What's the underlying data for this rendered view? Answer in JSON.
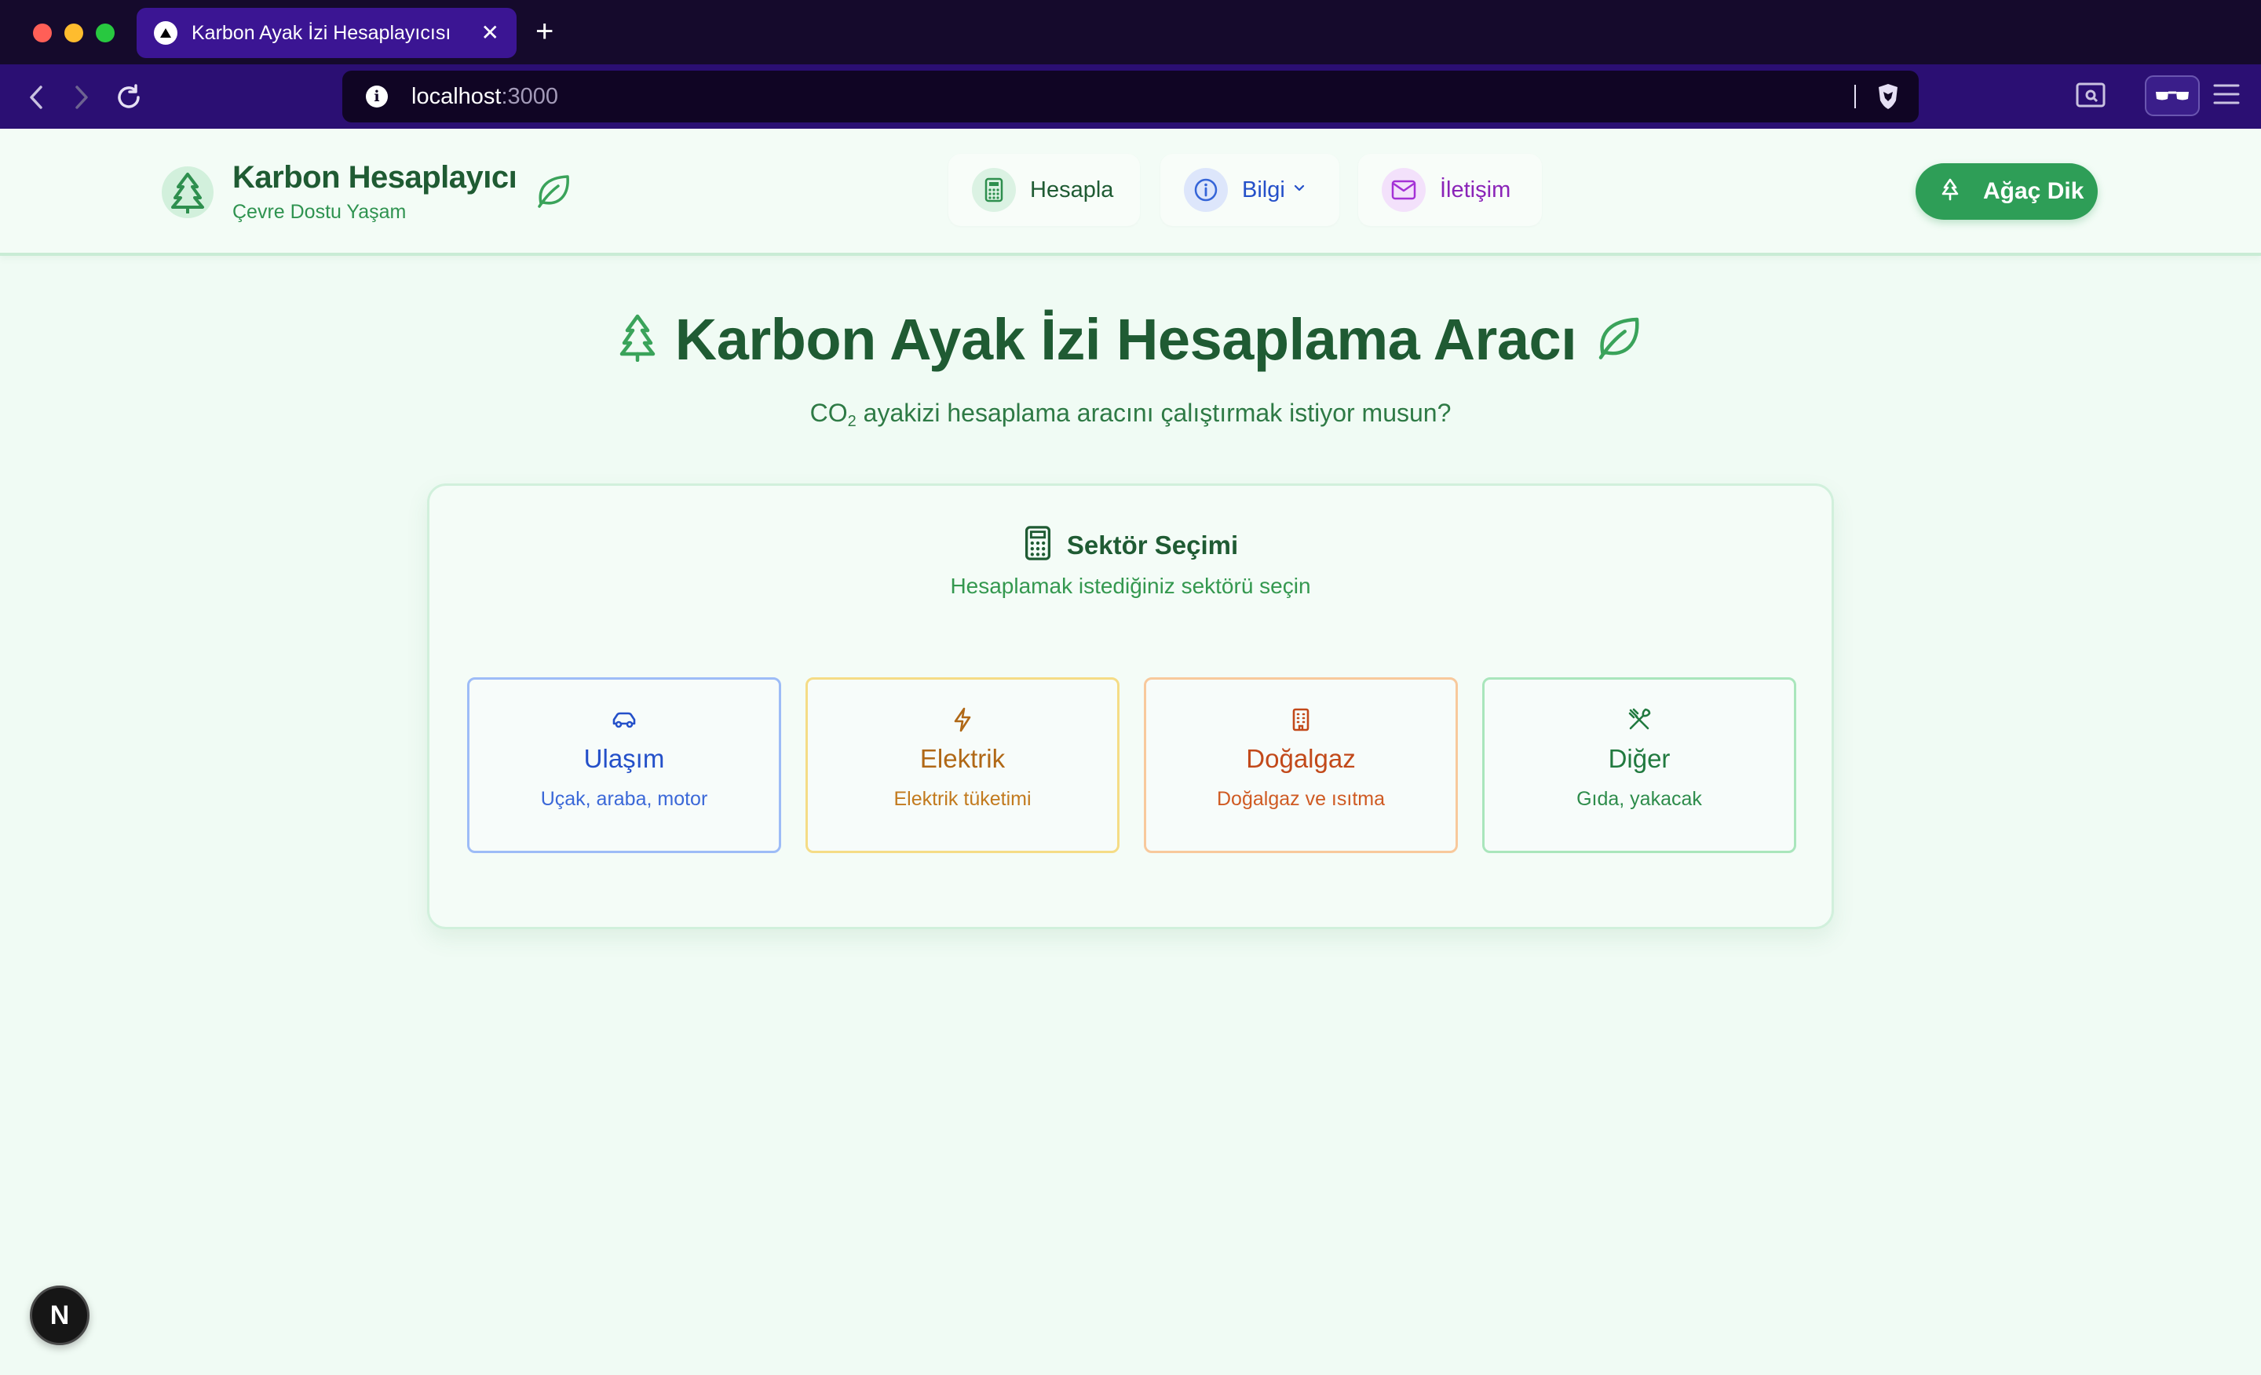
{
  "browser": {
    "tab_title": "Karbon Ayak İzi Hesaplayıcısı",
    "tab_close": "✕",
    "new_tab": "+",
    "url_host": "localhost",
    "url_port": ":3000"
  },
  "header": {
    "brand_title": "Karbon Hesaplayıcı",
    "brand_subtitle": "Çevre Dostu Yaşam",
    "nav": [
      {
        "label": "Hesapla",
        "icon": "calculator-icon"
      },
      {
        "label": "Bilgi",
        "icon": "info-icon"
      },
      {
        "label": "İletişim",
        "icon": "mail-icon"
      }
    ],
    "cta_label": "Ağaç Dik"
  },
  "hero": {
    "title": "Karbon Ayak İzi Hesaplama Aracı",
    "subtitle_prefix": "CO",
    "subtitle_subscript": "2",
    "subtitle_rest": " ayakizi hesaplama aracını çalıştırmak istiyor musun?"
  },
  "card": {
    "title": "Sektör Seçimi",
    "description": "Hesaplamak istediğiniz sektörü seçin",
    "sectors": [
      {
        "name": "Ulaşım",
        "desc": "Uçak, araba, motor",
        "icon": "car-icon",
        "color": "#2450c9"
      },
      {
        "name": "Elektrik",
        "desc": "Elektrik tüketimi",
        "icon": "zap-icon",
        "color": "#b06816"
      },
      {
        "name": "Doğalgaz",
        "desc": "Doğalgaz ve ısıtma",
        "icon": "building-icon",
        "color": "#c2491a"
      },
      {
        "name": "Diğer",
        "desc": "Gıda, yakacak",
        "icon": "utensils-icon",
        "color": "#217a3f"
      }
    ]
  },
  "dev_badge": "N",
  "colors": {
    "brand_green": "#2e9e57",
    "dark_green": "#1f5b33",
    "page_bg": "#f0fbf4",
    "tabbar_bg": "#150a2c",
    "toolbar_bg": "#2b0f73"
  }
}
